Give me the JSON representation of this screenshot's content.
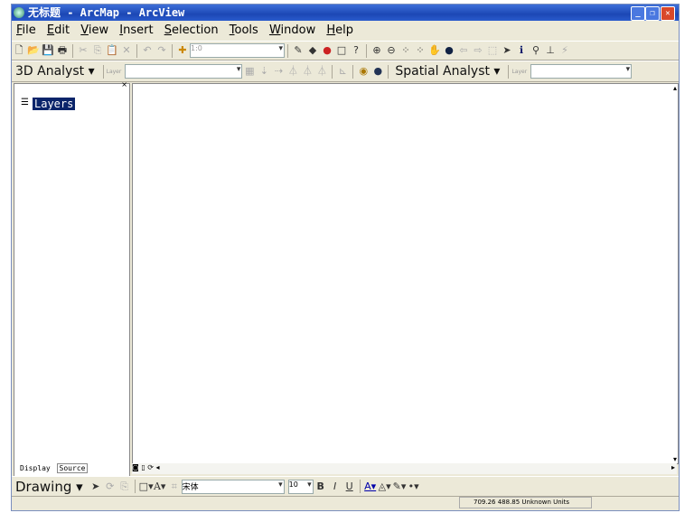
{
  "window": {
    "title": "无标题 - ArcMap - ArcView",
    "controls": [
      "minimize",
      "restore",
      "close"
    ]
  },
  "menu": [
    {
      "label": "File",
      "key": "F",
      "rest": "ile"
    },
    {
      "label": "Edit",
      "key": "E",
      "rest": "dit"
    },
    {
      "label": "View",
      "key": "V",
      "rest": "iew"
    },
    {
      "label": "Insert",
      "key": "I",
      "rest": "nsert"
    },
    {
      "label": "Selection",
      "key": "S",
      "rest": "election"
    },
    {
      "label": "Tools",
      "key": "T",
      "rest": "ools"
    },
    {
      "label": "Window",
      "key": "W",
      "rest": "indow"
    },
    {
      "label": "Help",
      "key": "H",
      "rest": "elp"
    }
  ],
  "standard_toolbar": {
    "scale_value": "1:0"
  },
  "analyst_toolbar": {
    "analyst_3d": "3D Analyst ▾",
    "layer_label": "Layer",
    "spatial_analyst": "Spatial Analyst ▾",
    "spatial_layer_label": "Layer"
  },
  "toc": {
    "root": "Layers",
    "tabs": [
      "Display",
      "Source"
    ]
  },
  "drawing_toolbar": {
    "drawing": "Drawing ▾",
    "font": "宋体",
    "size": "10"
  },
  "status": {
    "coordinates": "709.26  488.85 Unknown Units"
  }
}
